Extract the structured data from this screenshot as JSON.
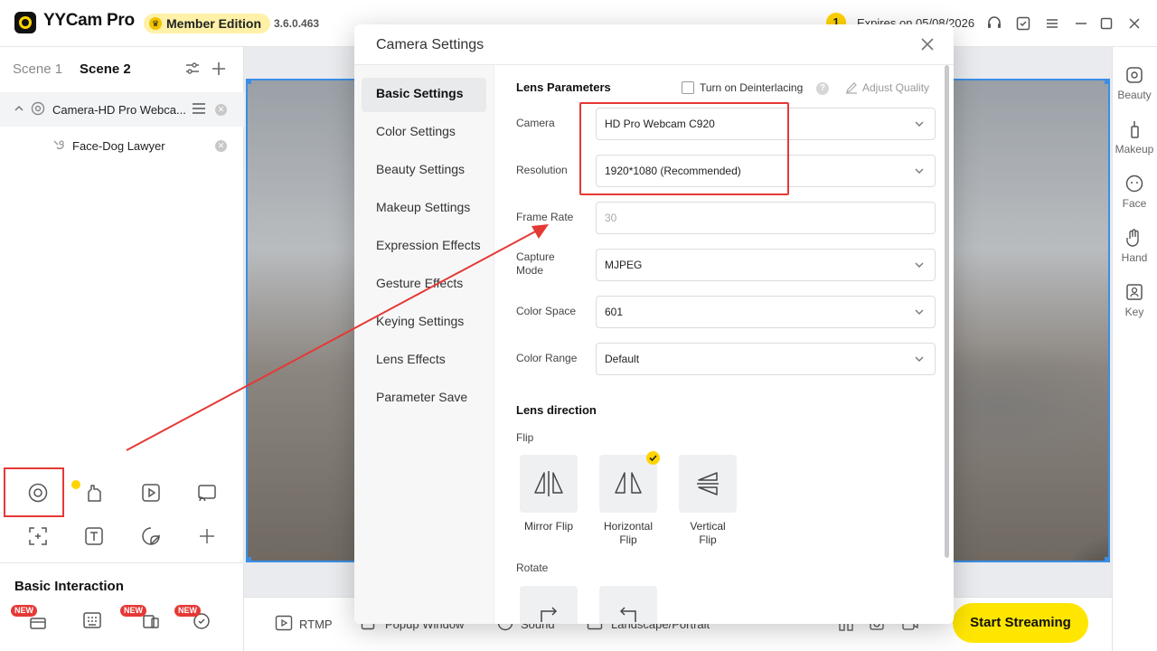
{
  "app": {
    "title": "YYCam Pro",
    "member_badge": "Member Edition",
    "version": "3.6.0.463",
    "notification_count": "1",
    "expires": "Expires on 05/08/2026"
  },
  "scenes": {
    "tabs": [
      "Scene 1",
      "Scene 2"
    ],
    "active_index": 1
  },
  "sources": {
    "main": "Camera-HD Pro Webca...",
    "sub": "Face-Dog Lawyer"
  },
  "left_panel": {
    "basic_interaction": "Basic Interaction",
    "new_badge": "NEW"
  },
  "bottom_bar": {
    "rtmp": "RTMP",
    "popup_window": "Popup Window",
    "sound": "Sound",
    "landscape_portrait": "Landscape/Portrait",
    "start_streaming": "Start Streaming"
  },
  "right_rail": [
    "Beauty",
    "Makeup",
    "Face",
    "Hand",
    "Key"
  ],
  "dialog": {
    "title": "Camera Settings",
    "nav": [
      "Basic Settings",
      "Color Settings",
      "Beauty Settings",
      "Makeup Settings",
      "Expression Effects",
      "Gesture Effects",
      "Keying Settings",
      "Lens Effects",
      "Parameter Save"
    ],
    "nav_active": 0,
    "lens_parameters": "Lens Parameters",
    "deinterlacing": "Turn on Deinterlacing",
    "deinterlacing_checked": false,
    "help": "?",
    "adjust_quality": "Adjust Quality",
    "fields": {
      "camera": {
        "label": "Camera",
        "value": "HD Pro Webcam C920"
      },
      "resolution": {
        "label": "Resolution",
        "value": "1920*1080 (Recommended)"
      },
      "frame_rate": {
        "label": "Frame Rate",
        "value": "30"
      },
      "capture_mode": {
        "label_1": "Capture",
        "label_2": "Mode",
        "value": "MJPEG"
      },
      "color_space": {
        "label": "Color Space",
        "value": "601"
      },
      "color_range": {
        "label": "Color Range",
        "value": "Default"
      }
    },
    "lens_direction": "Lens direction",
    "flip": "Flip",
    "flip_options": {
      "mirror": "Mirror Flip",
      "horizontal_1": "Horizontal",
      "horizontal_2": "Flip",
      "vertical_1": "Vertical",
      "vertical_2": "Flip"
    },
    "flip_selected": "horizontal",
    "rotate": "Rotate"
  },
  "colors": {
    "accent_yellow": "#ffe600",
    "highlight_red": "#e53935",
    "selection_blue": "#3a8ee6"
  }
}
